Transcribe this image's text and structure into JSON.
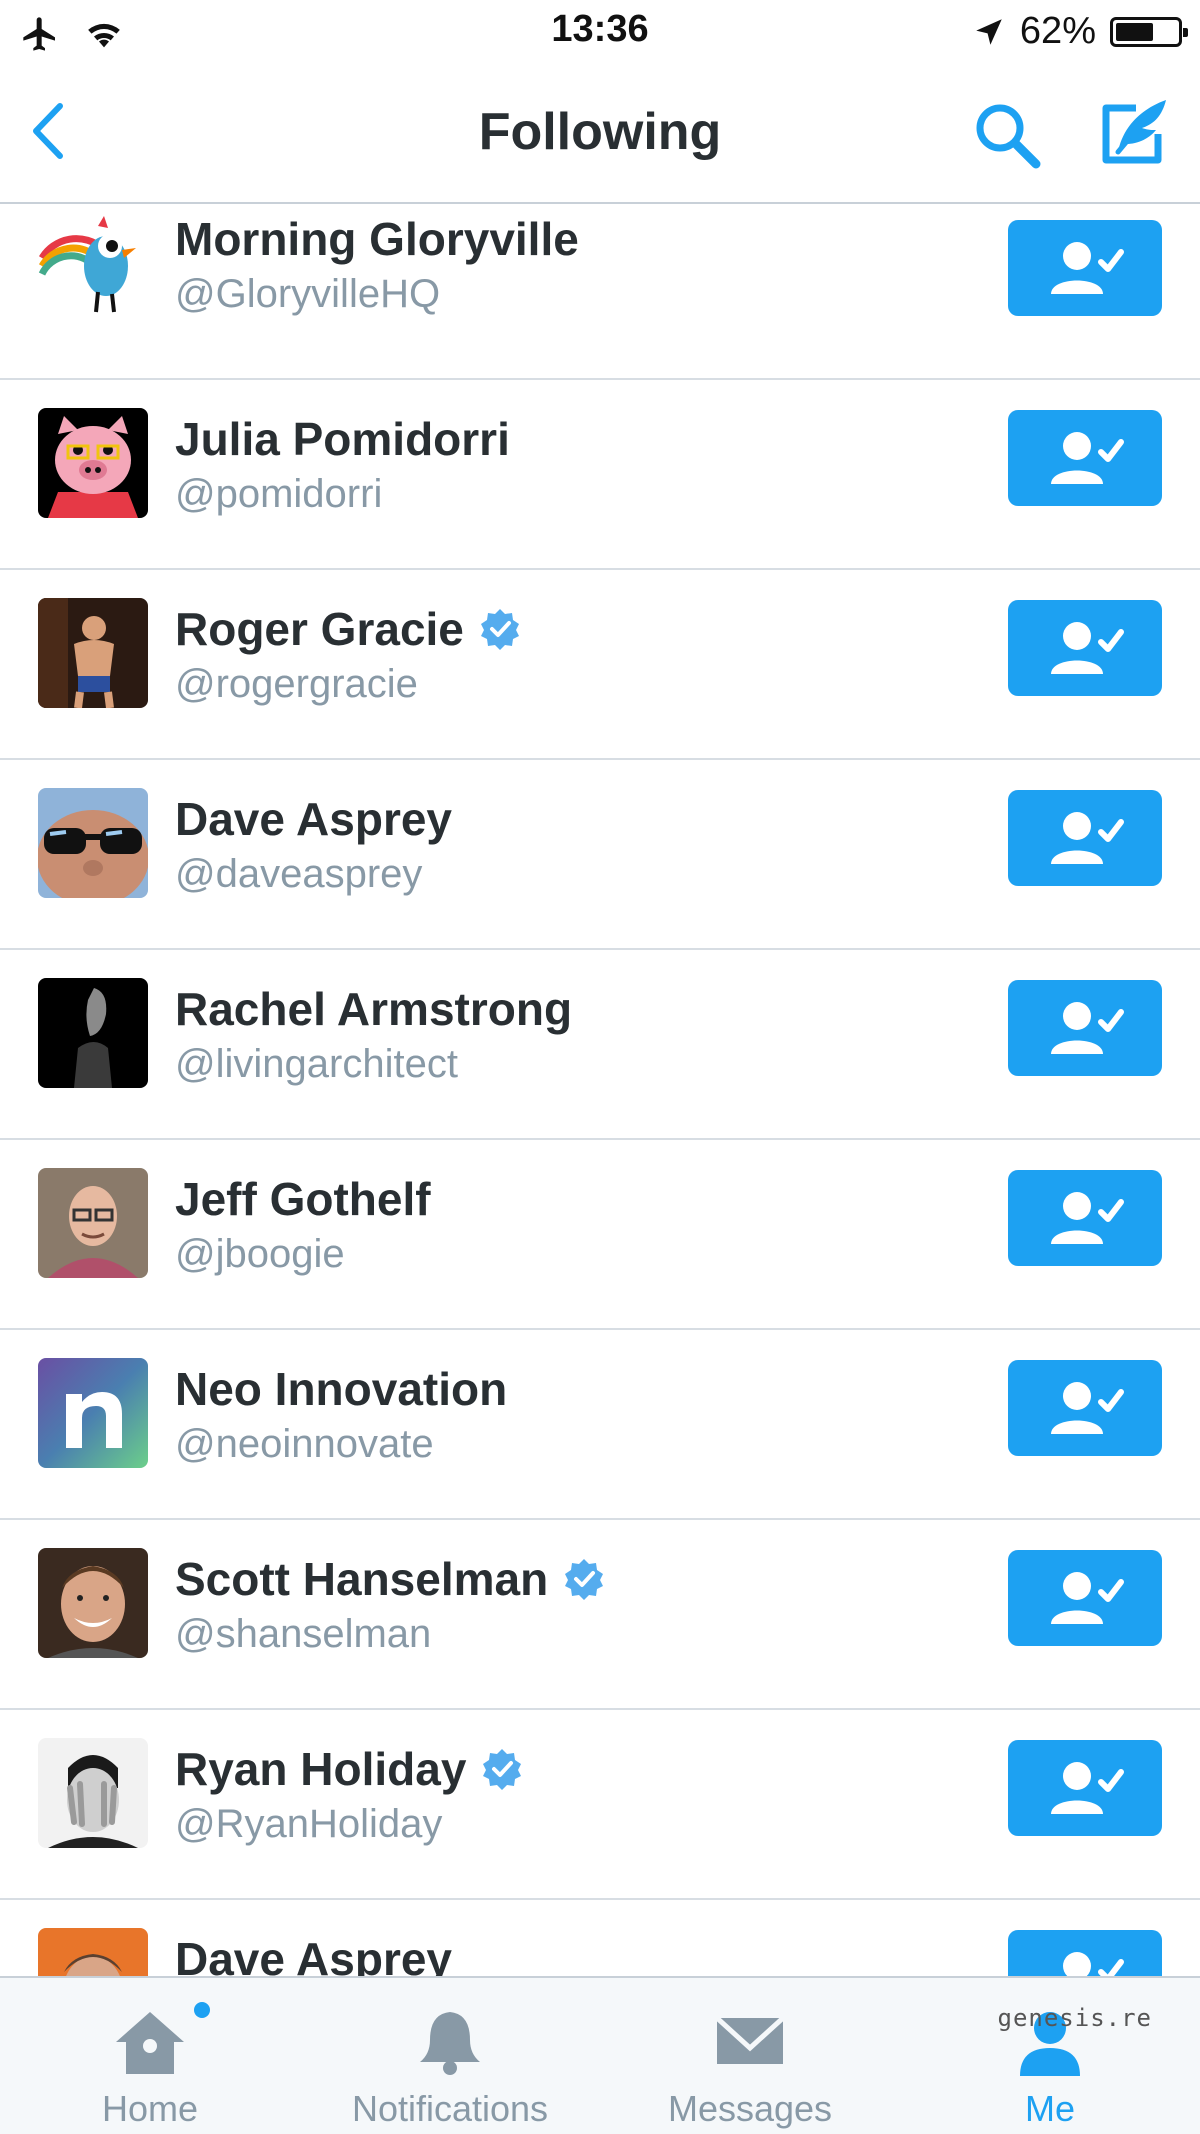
{
  "status_bar": {
    "time": "13:36",
    "battery": "62",
    "battery_suffix": "%",
    "battery_level": 0.62
  },
  "header": {
    "title": "Following"
  },
  "accounts": [
    {
      "name": "Morning Gloryville",
      "handle": "@GloryvilleHQ",
      "verified": false
    },
    {
      "name": "Julia Pomidorri",
      "handle": "@pomidorri",
      "verified": false
    },
    {
      "name": "Roger Gracie",
      "handle": "@rogergracie",
      "verified": true
    },
    {
      "name": "Dave Asprey",
      "handle": "@daveasprey",
      "verified": false
    },
    {
      "name": "Rachel Armstrong",
      "handle": "@livingarchitect",
      "verified": false
    },
    {
      "name": "Jeff Gothelf",
      "handle": "@jboogie",
      "verified": false
    },
    {
      "name": "Neo Innovation",
      "handle": "@neoinnovate",
      "verified": false
    },
    {
      "name": "Scott Hanselman",
      "handle": "@shanselman",
      "verified": true
    },
    {
      "name": "Ryan Holiday",
      "handle": "@RyanHoliday",
      "verified": true
    },
    {
      "name": "Dave Asprey",
      "handle": "",
      "verified": false
    }
  ],
  "tabs": [
    {
      "label": "Home",
      "icon": "home-icon",
      "active": false,
      "badge": true
    },
    {
      "label": "Notifications",
      "icon": "bell-icon",
      "active": false
    },
    {
      "label": "Messages",
      "icon": "envelope-icon",
      "active": false
    },
    {
      "label": "Me",
      "icon": "person-icon",
      "active": true
    }
  ],
  "watermark": "genesis.re",
  "colors": {
    "accent": "#1da1f2",
    "verified": "#55acee",
    "muted": "#8899a6",
    "text": "#292f33"
  }
}
